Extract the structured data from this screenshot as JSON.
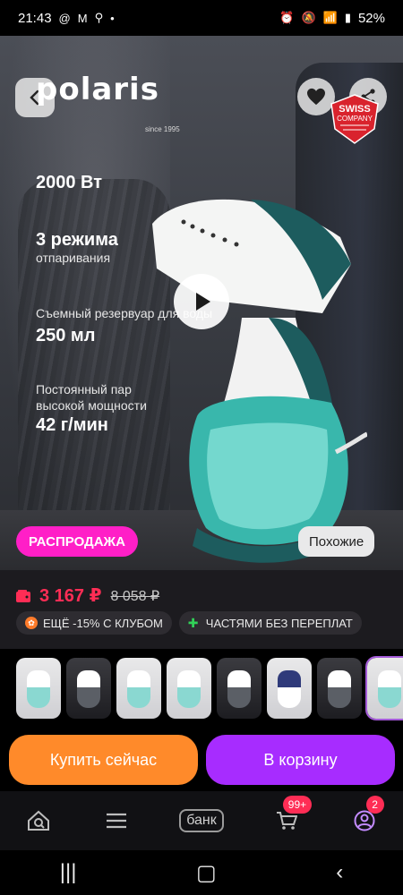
{
  "status_bar": {
    "time": "21:43",
    "left_icons": [
      "mail-icon",
      "m-icon",
      "person-icon",
      "dot-icon"
    ],
    "right_icons": [
      "alarm-icon",
      "mute-icon",
      "wifi-icon",
      "signal-icon"
    ],
    "battery": "52%"
  },
  "hero": {
    "brand": "polaris",
    "brand_sub": "since 1995",
    "badge_top": "SWISS",
    "badge_bottom": "COMPANY",
    "specs": [
      {
        "value": "2000 Вт",
        "caption": ""
      },
      {
        "value": "3 режима",
        "caption": "отпаривания"
      },
      {
        "caption": "Съемный резервуар для воды",
        "value": "250 мл"
      },
      {
        "caption_line1": "Постоянный пар",
        "caption_line2": "высокой мощности",
        "value": "42 г/мин"
      }
    ],
    "sale_label": "РАСПРОДАЖА",
    "similar_label": "Похожие"
  },
  "price": {
    "current": "3 167 ₽",
    "old": "8 058 ₽",
    "promos": [
      {
        "icon": "club-icon",
        "text": "ЕЩЁ -15% С КЛУБОМ"
      },
      {
        "icon": "plus-icon",
        "text": "ЧАСТЯМИ БЕЗ ПЕРЕПЛАТ"
      }
    ]
  },
  "thumbnails": [
    {
      "style": "light"
    },
    {
      "style": "dark"
    },
    {
      "style": "light"
    },
    {
      "style": "light"
    },
    {
      "style": "dark"
    },
    {
      "style": "light"
    },
    {
      "style": "dark"
    },
    {
      "style": "light",
      "selected": true
    }
  ],
  "cta": {
    "buy": "Купить сейчас",
    "cart": "В корзину"
  },
  "bottom_nav": {
    "bank": "банк",
    "cart_badge": "99+",
    "profile_badge": "2"
  },
  "colors": {
    "sale_pink": "#ff1fc7",
    "buy_orange": "#ff8a2a",
    "cart_purple": "#a72cff",
    "price_red": "#ff2d55"
  }
}
